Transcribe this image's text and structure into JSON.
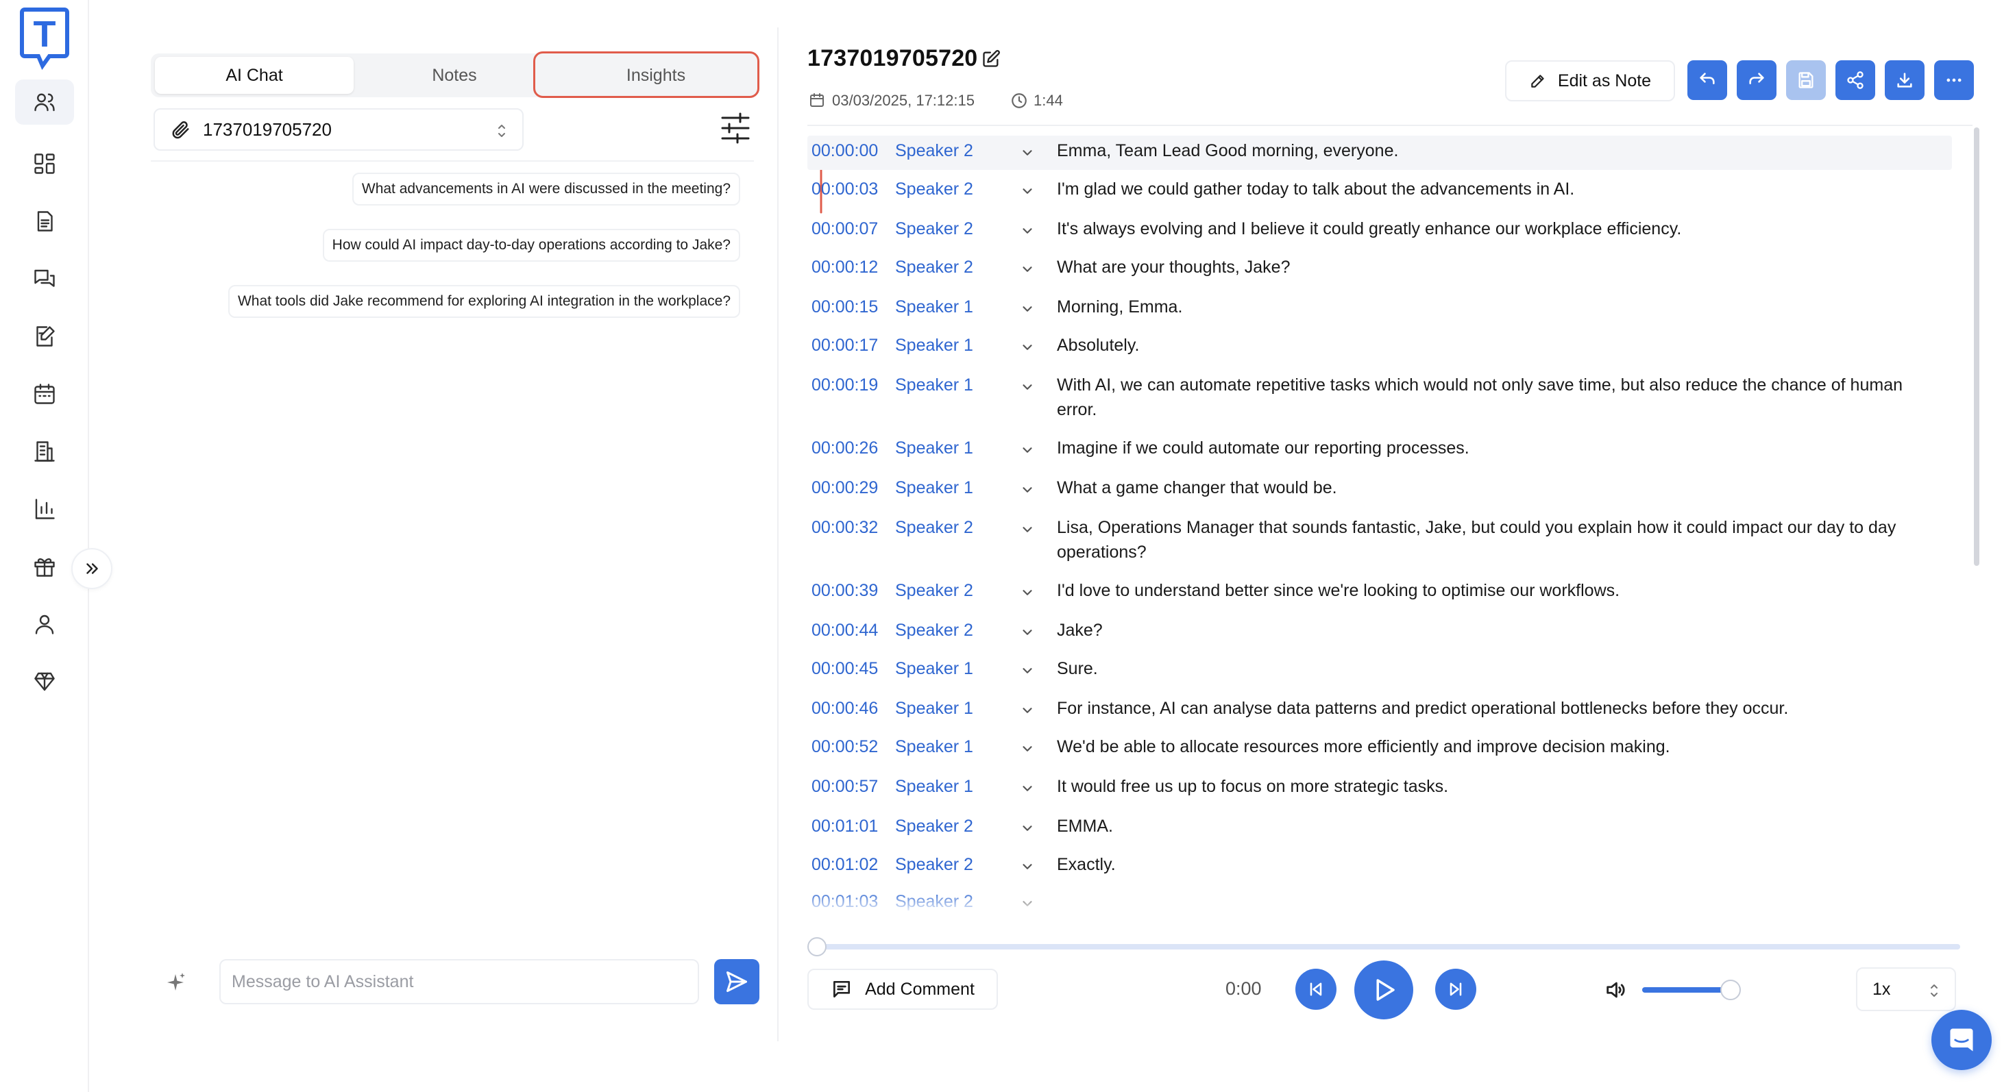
{
  "app": {
    "logo_letter": "T",
    "accent_color": "#3a74e0",
    "highlight_color": "#e05c4b"
  },
  "rail": {
    "items": [
      {
        "name": "users-icon",
        "active": true
      },
      {
        "name": "dashboard-icon",
        "active": false
      },
      {
        "name": "document-icon",
        "active": false
      },
      {
        "name": "chat-icon",
        "active": false
      },
      {
        "name": "notes-edit-icon",
        "active": false
      },
      {
        "name": "calendar-icon",
        "active": false
      },
      {
        "name": "building-icon",
        "active": false
      },
      {
        "name": "bar-chart-icon",
        "active": false
      },
      {
        "name": "gift-icon",
        "active": false
      },
      {
        "name": "user-icon",
        "active": false
      },
      {
        "name": "diamond-icon",
        "active": false
      }
    ]
  },
  "chat_panel": {
    "tabs": [
      {
        "label": "AI Chat",
        "active": true
      },
      {
        "label": "Notes",
        "active": false
      },
      {
        "label": "Insights",
        "active": false,
        "highlighted": true
      }
    ],
    "file_select": {
      "value": "1737019705720"
    },
    "suggestions": [
      "What advancements in AI were discussed in the meeting?",
      "How could AI impact day-to-day operations according to Jake?",
      "What tools did Jake recommend for exploring AI integration in the workplace?"
    ],
    "message_input": {
      "placeholder": "Message to AI Assistant",
      "value": ""
    }
  },
  "transcript_panel": {
    "title": "1737019705720",
    "date": "03/03/2025, 17:12:15",
    "duration": "1:44",
    "edit_as_note_label": "Edit as Note",
    "toolbar": [
      "undo-icon",
      "redo-icon",
      "save-icon",
      "share-icon",
      "download-icon",
      "more-icon"
    ],
    "rows": [
      {
        "time": "00:00:00",
        "speaker": "Speaker 2",
        "text": "Emma, Team Lead Good morning, everyone."
      },
      {
        "time": "00:00:03",
        "speaker": "Speaker 2",
        "text": "I'm glad we could gather today to talk about the advancements in AI."
      },
      {
        "time": "00:00:07",
        "speaker": "Speaker 2",
        "text": "It's always evolving and I believe it could greatly enhance our workplace efficiency."
      },
      {
        "time": "00:00:12",
        "speaker": "Speaker 2",
        "text": "What are your thoughts, Jake?"
      },
      {
        "time": "00:00:15",
        "speaker": "Speaker 1",
        "text": "Morning, Emma."
      },
      {
        "time": "00:00:17",
        "speaker": "Speaker 1",
        "text": "Absolutely."
      },
      {
        "time": "00:00:19",
        "speaker": "Speaker 1",
        "text": "With AI, we can automate repetitive tasks which would not only save time, but also reduce the chance of human error."
      },
      {
        "time": "00:00:26",
        "speaker": "Speaker 1",
        "text": "Imagine if we could automate our reporting processes."
      },
      {
        "time": "00:00:29",
        "speaker": "Speaker 1",
        "text": "What a game changer that would be."
      },
      {
        "time": "00:00:32",
        "speaker": "Speaker 2",
        "text": "Lisa, Operations Manager that sounds fantastic, Jake, but could you explain how it could impact our day to day operations?"
      },
      {
        "time": "00:00:39",
        "speaker": "Speaker 2",
        "text": "I'd love to understand better since we're looking to optimise our workflows."
      },
      {
        "time": "00:00:44",
        "speaker": "Speaker 2",
        "text": "Jake?"
      },
      {
        "time": "00:00:45",
        "speaker": "Speaker 1",
        "text": "Sure."
      },
      {
        "time": "00:00:46",
        "speaker": "Speaker 1",
        "text": "For instance, AI can analyse data patterns and predict operational bottlenecks before they occur."
      },
      {
        "time": "00:00:52",
        "speaker": "Speaker 1",
        "text": "We'd be able to allocate resources more efficiently and improve decision making."
      },
      {
        "time": "00:00:57",
        "speaker": "Speaker 1",
        "text": "It would free us up to focus on more strategic tasks."
      },
      {
        "time": "00:01:01",
        "speaker": "Speaker 2",
        "text": "EMMA."
      },
      {
        "time": "00:01:02",
        "speaker": "Speaker 2",
        "text": "Exactly."
      },
      {
        "time": "00:01:03",
        "speaker": "Speaker 2",
        "text": ""
      }
    ]
  },
  "player": {
    "add_comment_label": "Add Comment",
    "current_time": "0:00",
    "progress_fraction": 0.0,
    "volume_fraction": 1.0,
    "speed": "1x"
  }
}
